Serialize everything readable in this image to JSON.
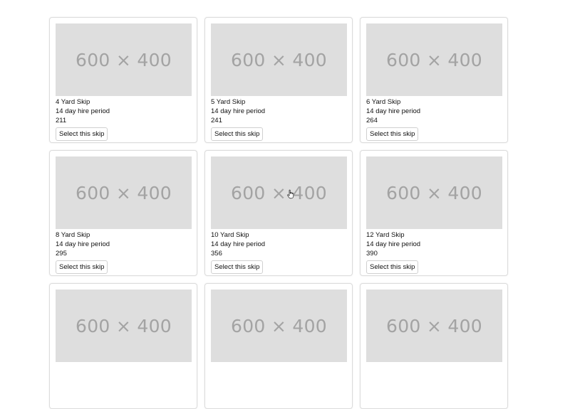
{
  "skips": [
    {
      "image_text": "600 × 400",
      "title": "4 Yard Skip",
      "period": "14 day hire period",
      "price": "211",
      "button_label": "Select this skip"
    },
    {
      "image_text": "600 × 400",
      "title": "5 Yard Skip",
      "period": "14 day hire period",
      "price": "241",
      "button_label": "Select this skip"
    },
    {
      "image_text": "600 × 400",
      "title": "6 Yard Skip",
      "period": "14 day hire period",
      "price": "264",
      "button_label": "Select this skip"
    },
    {
      "image_text": "600 × 400",
      "title": "8 Yard Skip",
      "period": "14 day hire period",
      "price": "295",
      "button_label": "Select this skip"
    },
    {
      "image_text": "600 × 400",
      "title": "10 Yard Skip",
      "period": "14 day hire period",
      "price": "356",
      "button_label": "Select this skip"
    },
    {
      "image_text": "600 × 400",
      "title": "12 Yard Skip",
      "period": "14 day hire period",
      "price": "390",
      "button_label": "Select this skip"
    },
    {
      "image_text": "600 × 400"
    },
    {
      "image_text": "600 × 400"
    },
    {
      "image_text": "600 × 400"
    }
  ]
}
